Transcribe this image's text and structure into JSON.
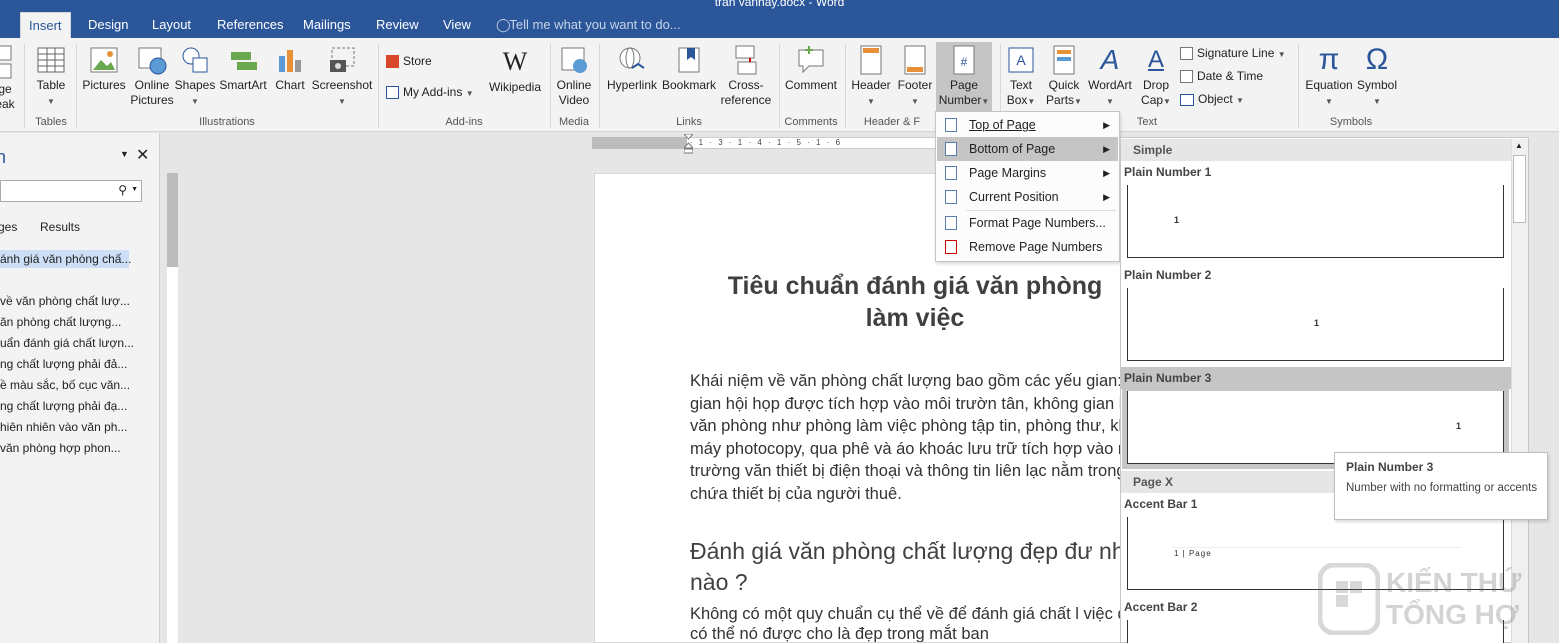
{
  "window": {
    "title": "tran vanhay.docx - Word"
  },
  "tabs": [
    {
      "label": "Insert",
      "active": true
    },
    {
      "label": "Design"
    },
    {
      "label": "Layout"
    },
    {
      "label": "References"
    },
    {
      "label": "Mailings"
    },
    {
      "label": "Review"
    },
    {
      "label": "View"
    }
  ],
  "tell_me": "Tell me what you want to do...",
  "ribbon": {
    "page_break_line1": "ge",
    "page_break_line2": "eak",
    "table": "Table",
    "pictures": "Pictures",
    "online_pictures_line1": "Online",
    "online_pictures_line2": "Pictures",
    "shapes": "Shapes",
    "smartart": "SmartArt",
    "chart": "Chart",
    "screenshot": "Screenshot",
    "store": "Store",
    "my_addins": "My Add-ins",
    "wikipedia": "Wikipedia",
    "online_video_line1": "Online",
    "online_video_line2": "Video",
    "hyperlink": "Hyperlink",
    "bookmark": "Bookmark",
    "cross_ref_line1": "Cross-",
    "cross_ref_line2": "reference",
    "comment": "Comment",
    "header": "Header",
    "footer": "Footer",
    "page_number_line1": "Page",
    "page_number_line2": "Number",
    "text_box_line1": "Text",
    "text_box_line2": "Box",
    "quick_parts_line1": "Quick",
    "quick_parts_line2": "Parts",
    "wordart": "WordArt",
    "drop_cap_line1": "Drop",
    "drop_cap_line2": "Cap",
    "signature_line": "Signature Line",
    "date_time": "Date & Time",
    "object": "Object",
    "equation": "Equation",
    "symbol": "Symbol",
    "groups": {
      "tables": "Tables",
      "illustrations": "Illustrations",
      "addins": "Add-ins",
      "media": "Media",
      "links": "Links",
      "comments": "Comments",
      "header_footer": "Header & F",
      "text": "Text",
      "symbols": "Symbols"
    }
  },
  "nav_pane": {
    "title": "n",
    "search_value": "",
    "tab_pages": "ges",
    "tab_results": "Results",
    "items": [
      "ánh giá văn phòng chấ...",
      "về văn phòng chất lượ...",
      "ăn phòng chất lượng...",
      "uẩn đánh giá chất lượn...",
      "ng chất lượng phải đả...",
      "ề màu sắc, bố cục văn...",
      "ng chất lượng phải đạ...",
      "hiên nhiên vào văn ph...",
      "văn phòng hợp phon..."
    ]
  },
  "ruler": {
    "text": "· 2 · 1 · 1 · 1 · 2 · 1 · 3 · 1 · 4 · 1 · 5 · 1 · 6"
  },
  "document": {
    "heading": "Tiêu chuẩn đánh giá văn phòng làm việc",
    "heading_line1": "Tiêu chuẩn đánh giá văn phòng",
    "heading_line2": "làm việc",
    "paragraph1": "Khái niệm về văn phòng chất lượng bao gồm các yếu gian: không gian hội họp được tích hợp vào môi trườn tân, không gian hỗ trợ văn phòng như phòng làm việc phòng tập tin, phòng thư, khu vực máy photocopy, qua phê và áo khoác lưu trữ tích hợp vào môi trường văn thiết bị điện thoại và thông tin liên lạc nằm trong các d chứa thiết bị của người thuê.",
    "heading2": "Đánh giá văn phòng chất lượng đẹp đư như thế nào ?",
    "paragraph2": "Không có một quy chuẩn cụ thể về  để đánh giá chất l việc đẹp bởi có thể nó được cho là đẹp trong mắt ban"
  },
  "page_number_menu": {
    "items": [
      {
        "label": "Top of Page",
        "submenu": true
      },
      {
        "label": "Bottom of Page",
        "submenu": true,
        "highlighted": true
      },
      {
        "label": "Page Margins",
        "submenu": true
      },
      {
        "label": "Current Position",
        "submenu": true
      },
      {
        "label": "Format Page Numbers..."
      },
      {
        "label": "Remove Page Numbers"
      }
    ]
  },
  "gallery": {
    "sections": {
      "simple": "Simple",
      "page_x": "Page X"
    },
    "items": {
      "plain1": "Plain Number 1",
      "plain2": "Plain Number 2",
      "plain3": "Plain Number 3",
      "accent1": "Accent Bar 1",
      "accent2": "Accent Bar 2"
    },
    "preview_number": "1",
    "accent_preview": "1 | Page"
  },
  "tooltip": {
    "title": "Plain Number 3",
    "description": "Number with no formatting or accents"
  },
  "watermark": {
    "line1": "KIẾN THỨ",
    "line2": "TỔNG HỢ"
  },
  "colors": {
    "word_blue": "#2b579a",
    "ribbon_bg": "#f3f3f3",
    "highlight": "#c5c5c5"
  }
}
